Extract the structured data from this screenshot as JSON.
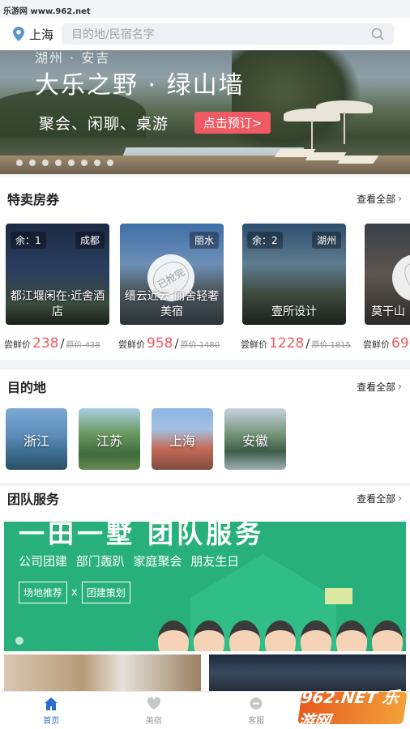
{
  "watermark": {
    "top_text": "乐游网 www.962.net",
    "bottom_text": "962.NET 乐游网"
  },
  "location": {
    "city": "上海",
    "icon": "location-pin-icon"
  },
  "search": {
    "placeholder": "目的地/民宿名字",
    "icon": "search-icon"
  },
  "banner": {
    "subtitle": "湖州 · 安吉",
    "title": "大乐之野 · 绿山墙",
    "tagline": "聚会、闲聊、桌游",
    "cta": "点击预订>",
    "cta_color": "#f05a62",
    "slide_count": 8
  },
  "deals": {
    "title": "特卖房券",
    "more": "查看全部",
    "items": [
      {
        "remain": "余：1",
        "city": "成都",
        "name": "都江堰闲在·近舍酒店",
        "price_label": "尝鲜价",
        "price": "238",
        "orig": "原价 438",
        "sold_out": false
      },
      {
        "remain": "",
        "city": "丽水",
        "name": "缙云近云 丽舍轻奢美宿",
        "price_label": "尝鲜价",
        "price": "958",
        "orig": "原价 1480",
        "sold_out": true,
        "sold_text": "已抢完"
      },
      {
        "remain": "余：2",
        "city": "湖州",
        "name": "壹所设计",
        "price_label": "尝鲜价",
        "price": "1228",
        "orig": "原价 1815",
        "sold_out": false
      },
      {
        "remain": "",
        "city": "",
        "name": "莫干山",
        "price_label": "尝鲜价",
        "price": "69",
        "orig": "",
        "sold_out": true,
        "sold_text": "已"
      }
    ]
  },
  "destinations": {
    "title": "目的地",
    "more": "查看全部",
    "items": [
      {
        "name": "浙江"
      },
      {
        "name": "江苏"
      },
      {
        "name": "上海"
      },
      {
        "name": "安徽"
      }
    ]
  },
  "team": {
    "title": "团队服务",
    "more": "查看全部",
    "headline": "一田一墅 团队服务",
    "sub": "公司团建 部门轰趴 家庭聚会 朋友生日",
    "tag1": "场地推荐",
    "x": "x",
    "tag2": "团建策划",
    "color": "#27b07c"
  },
  "tabbar": {
    "items": [
      {
        "label": "首页",
        "icon": "home-icon",
        "active": true
      },
      {
        "label": "美宿",
        "icon": "heart-icon",
        "active": false
      },
      {
        "label": "客服",
        "icon": "chat-icon",
        "active": false
      }
    ],
    "active_color": "#2a6fcf"
  }
}
